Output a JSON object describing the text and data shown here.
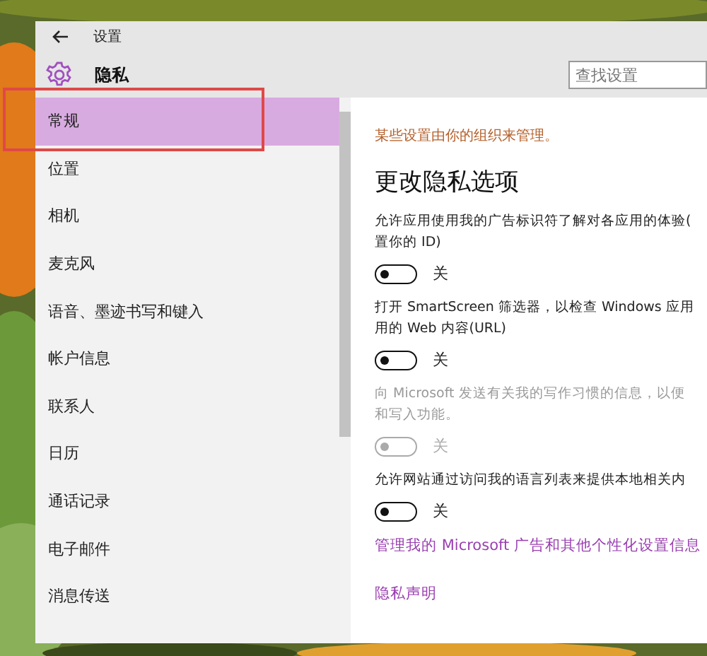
{
  "window": {
    "title": "设置"
  },
  "header": {
    "title": "隐私"
  },
  "search": {
    "placeholder": "查找设置"
  },
  "sidebar": {
    "items": [
      {
        "label": "常规",
        "selected": true,
        "outlined": true
      },
      {
        "label": "位置",
        "selected": false,
        "outlined": false
      },
      {
        "label": "相机",
        "selected": false,
        "outlined": false
      },
      {
        "label": "麦克风",
        "selected": false,
        "outlined": false
      },
      {
        "label": "语音、墨迹书写和键入",
        "selected": false,
        "outlined": false
      },
      {
        "label": "帐户信息",
        "selected": false,
        "outlined": false
      },
      {
        "label": "联系人",
        "selected": false,
        "outlined": false
      },
      {
        "label": "日历",
        "selected": false,
        "outlined": false
      },
      {
        "label": "通话记录",
        "selected": false,
        "outlined": false
      },
      {
        "label": "电子邮件",
        "selected": false,
        "outlined": false
      },
      {
        "label": "消息传送",
        "selected": false,
        "outlined": false
      }
    ]
  },
  "content": {
    "notice": "某些设置由你的组织来管理。",
    "heading": "更改隐私选项",
    "settings": [
      {
        "lines": [
          "允许应用使用我的广告标识符了解对各应用的体验(",
          "置你的 ID)"
        ],
        "on": false,
        "disabled": false,
        "state_label": "关"
      },
      {
        "lines": [
          "打开 SmartScreen 筛选器，以检查 Windows 应用",
          "用的 Web 内容(URL)"
        ],
        "on": false,
        "disabled": false,
        "state_label": "关"
      },
      {
        "lines": [
          "向 Microsoft 发送有关我的写作习惯的信息，以便",
          "和写入功能。"
        ],
        "on": false,
        "disabled": true,
        "state_label": "关"
      },
      {
        "lines": [
          "允许网站通过访问我的语言列表来提供本地相关内"
        ],
        "on": false,
        "disabled": false,
        "state_label": "关"
      }
    ],
    "links": [
      "管理我的 Microsoft 广告和其他个性化设置信息",
      "隐私声明"
    ]
  }
}
